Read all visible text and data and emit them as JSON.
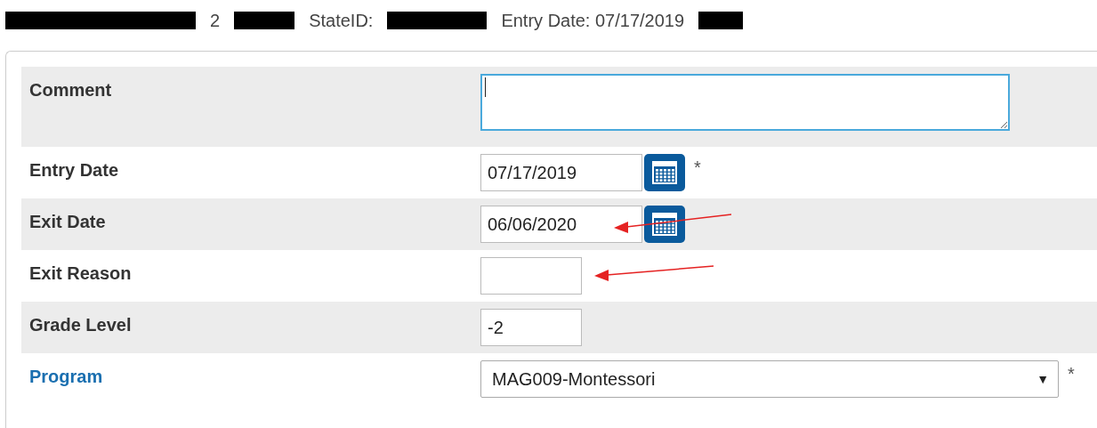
{
  "header": [
    {
      "kind": "redacted"
    },
    {
      "kind": "text",
      "text": "2"
    },
    {
      "kind": "redacted"
    },
    {
      "kind": "text",
      "text": "StateID:"
    },
    {
      "kind": "redacted"
    },
    {
      "kind": "text",
      "text": "Entry Date: 07/17/2019"
    },
    {
      "kind": "redacted"
    }
  ],
  "form": {
    "rows": [
      {
        "label": "Comment",
        "link": false,
        "kind": "textarea",
        "value": "",
        "focused": true,
        "required": false,
        "arrow": false
      },
      {
        "label": "Entry Date",
        "link": false,
        "kind": "date",
        "value": "07/17/2019",
        "required": true,
        "arrow": false
      },
      {
        "label": "Exit Date",
        "link": false,
        "kind": "date",
        "value": "06/06/2020",
        "required": false,
        "arrow": true
      },
      {
        "label": "Exit Reason",
        "link": false,
        "kind": "text",
        "value": "",
        "required": false,
        "arrow": true
      },
      {
        "label": "Grade Level",
        "link": false,
        "kind": "text",
        "value": "-2",
        "required": false,
        "arrow": false
      },
      {
        "label": "Program",
        "link": true,
        "kind": "select",
        "value": "MAG009-Montessori",
        "required": true,
        "arrow": false
      }
    ],
    "required_mark": "*",
    "select_caret": "▼"
  }
}
